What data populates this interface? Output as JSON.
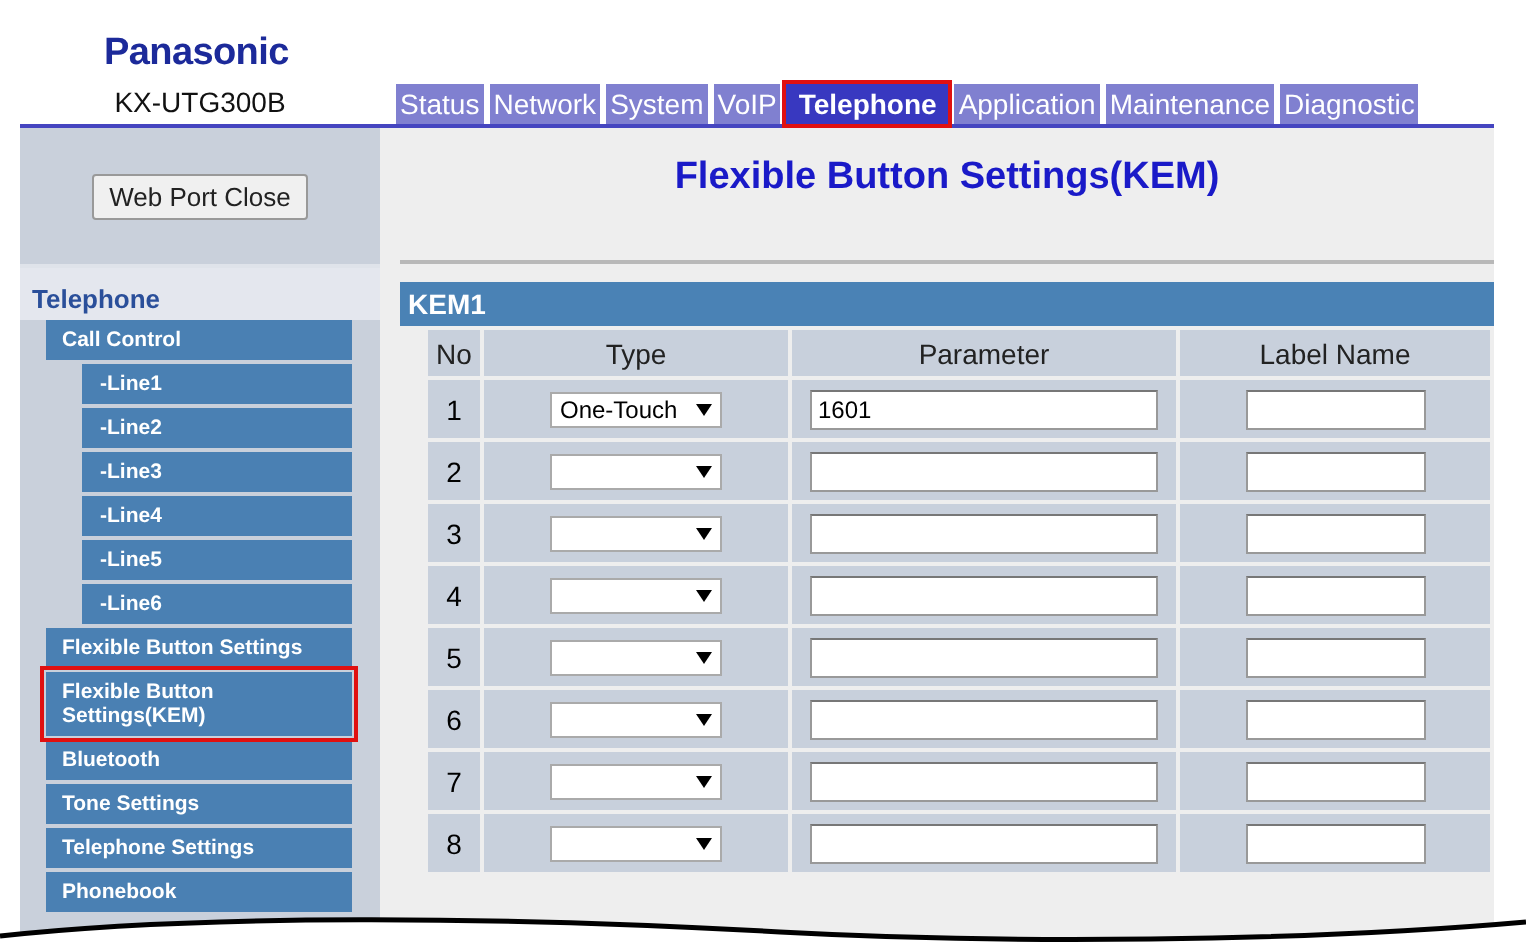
{
  "logo": "Panasonic",
  "model": "KX-UTG300B",
  "tabs": [
    {
      "label": "Status",
      "selected": false
    },
    {
      "label": "Network",
      "selected": false
    },
    {
      "label": "System",
      "selected": false
    },
    {
      "label": "VoIP",
      "selected": false
    },
    {
      "label": "Telephone",
      "selected": true
    },
    {
      "label": "Application",
      "selected": false
    },
    {
      "label": "Maintenance",
      "selected": false
    },
    {
      "label": "Diagnostic",
      "selected": false
    }
  ],
  "web_port_button": "Web Port Close",
  "sidebar": {
    "heading": "Telephone",
    "items": [
      {
        "label": "Call Control",
        "selected": false,
        "children": [
          {
            "label": "-Line1",
            "selected": false
          },
          {
            "label": "-Line2",
            "selected": false
          },
          {
            "label": "-Line3",
            "selected": false
          },
          {
            "label": "-Line4",
            "selected": false
          },
          {
            "label": "-Line5",
            "selected": false
          },
          {
            "label": "-Line6",
            "selected": false
          }
        ]
      },
      {
        "label": "Flexible Button Settings",
        "selected": false
      },
      {
        "label": "Flexible Button Settings(KEM)",
        "selected": true
      },
      {
        "label": "Bluetooth",
        "selected": false
      },
      {
        "label": "Tone Settings",
        "selected": false
      },
      {
        "label": "Telephone Settings",
        "selected": false
      },
      {
        "label": "Phonebook",
        "selected": false
      }
    ]
  },
  "page_title": "Flexible Button Settings(KEM)",
  "section": {
    "title": "KEM1",
    "columns": [
      "No",
      "Type",
      "Parameter",
      "Label Name"
    ],
    "rows": [
      {
        "no": "1",
        "type": "One-Touch",
        "parameter": "1601"
      },
      {
        "no": "2"
      },
      {
        "no": "3"
      },
      {
        "no": "4"
      },
      {
        "no": "5"
      },
      {
        "no": "6"
      },
      {
        "no": "7"
      },
      {
        "no": "8"
      }
    ]
  }
}
